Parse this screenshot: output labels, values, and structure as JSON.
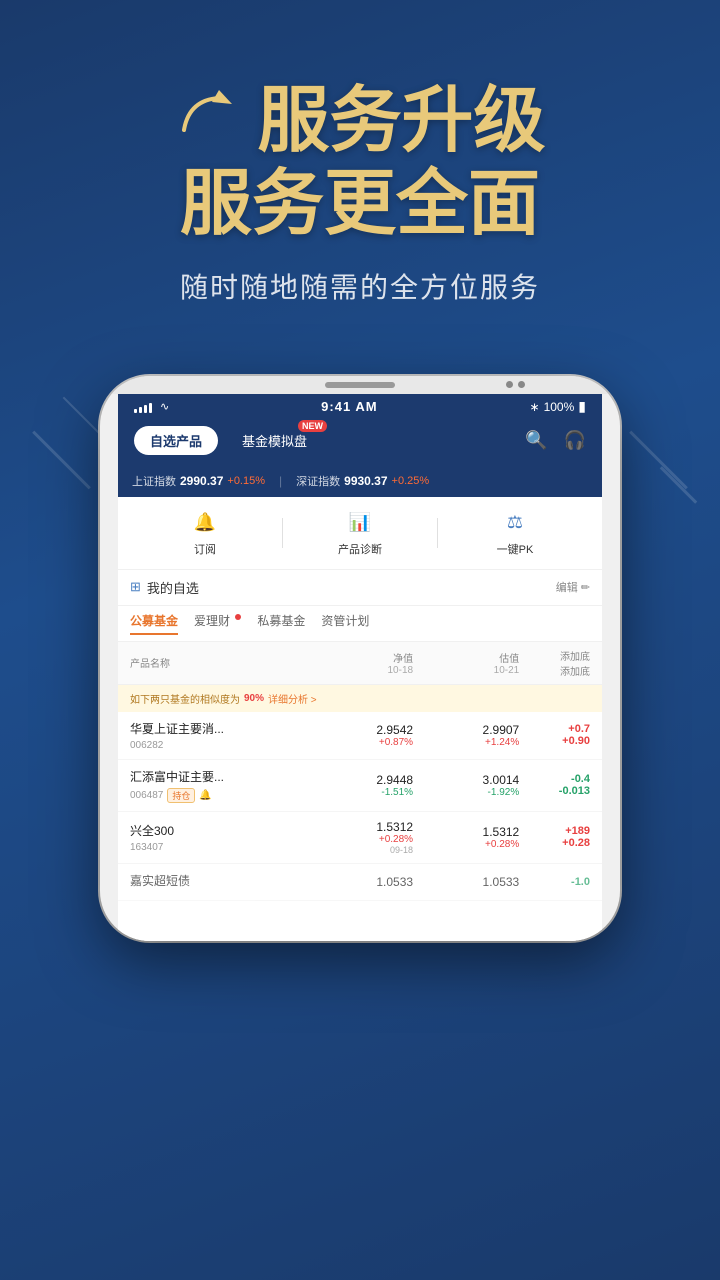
{
  "header": {
    "title_line1_icon": "↗",
    "title_line1": "服务升级",
    "title_line2": "服务更全面",
    "subtitle": "随时随地随需的全方位服务"
  },
  "status_bar": {
    "time": "9:41 AM",
    "signal": "all",
    "wifi": "wifi",
    "bluetooth": "*",
    "battery": "100%"
  },
  "app": {
    "tab_self_select": "自选产品",
    "tab_fund_sim": "基金模拟盘",
    "tab_new_badge": "NEW",
    "icon_search": "🔍",
    "icon_headset": "🎧"
  },
  "ticker": {
    "sh_label": "上证指数",
    "sh_value": "2990.37",
    "sh_change": "+0.15%",
    "sz_label": "深证指数",
    "sz_value": "9930.37",
    "sz_change": "+0.25%"
  },
  "quick_actions": [
    {
      "icon": "🔔",
      "label": "订阅"
    },
    {
      "icon": "📊",
      "label": "产品诊断"
    },
    {
      "icon": "⚖",
      "label": "一键PK"
    }
  ],
  "watchlist": {
    "title": "我的自选",
    "title_icon": "☰",
    "edit_label": "编辑",
    "edit_icon": "✏"
  },
  "fund_tabs": [
    {
      "label": "公募基金",
      "active": true,
      "dot": false
    },
    {
      "label": "爱理财",
      "active": false,
      "dot": true
    },
    {
      "label": "私募基金",
      "active": false,
      "dot": false
    },
    {
      "label": "资管计划",
      "active": false,
      "dot": false
    }
  ],
  "table_headers": {
    "name": "产品名称",
    "nav": "净值",
    "nav_date": "10-18",
    "est": "估值",
    "est_date": "10-21",
    "add": "添加底",
    "add2": "添加底"
  },
  "similarity_notice": {
    "text": "如下两只基金的相似度为",
    "pct": "90%",
    "link": "详细分析 >"
  },
  "funds": [
    {
      "name": "华夏上证主要消...",
      "code": "006282",
      "hold_badge": false,
      "bell": false,
      "nav": "2.9542",
      "nav_pct": "+0.87%",
      "nav_pct_pos": true,
      "est": "2.9907",
      "est_pct": "+1.24%",
      "est_pct_pos": true,
      "add": "+0.7",
      "add2": "+0.90",
      "add_pos": true
    },
    {
      "name": "汇添富中证主要...",
      "code": "006487",
      "hold_badge": true,
      "bell": true,
      "nav": "2.9448",
      "nav_pct": "-1.51%",
      "nav_pct_pos": false,
      "est": "3.0014",
      "est_pct": "-1.92%",
      "est_pct_pos": false,
      "add": "-0.4",
      "add2": "-0.013",
      "add_pos": false
    },
    {
      "name": "兴全300",
      "code": "163407",
      "hold_badge": false,
      "bell": false,
      "nav": "1.5312",
      "nav_pct": "+0.28%",
      "nav_pct_pos": true,
      "nav_date": "09-18",
      "est": "1.5312",
      "est_pct": "+0.28%",
      "est_pct_pos": true,
      "add": "+189",
      "add2": "+0.28",
      "add_pos": true
    },
    {
      "name": "嘉实超短债",
      "code": "",
      "hold_badge": false,
      "bell": false,
      "nav": "1.0533",
      "nav_pct": "",
      "est": "1.0533",
      "est_pct": "",
      "add": "-1.0",
      "add2": "",
      "add_pos": false
    }
  ]
}
